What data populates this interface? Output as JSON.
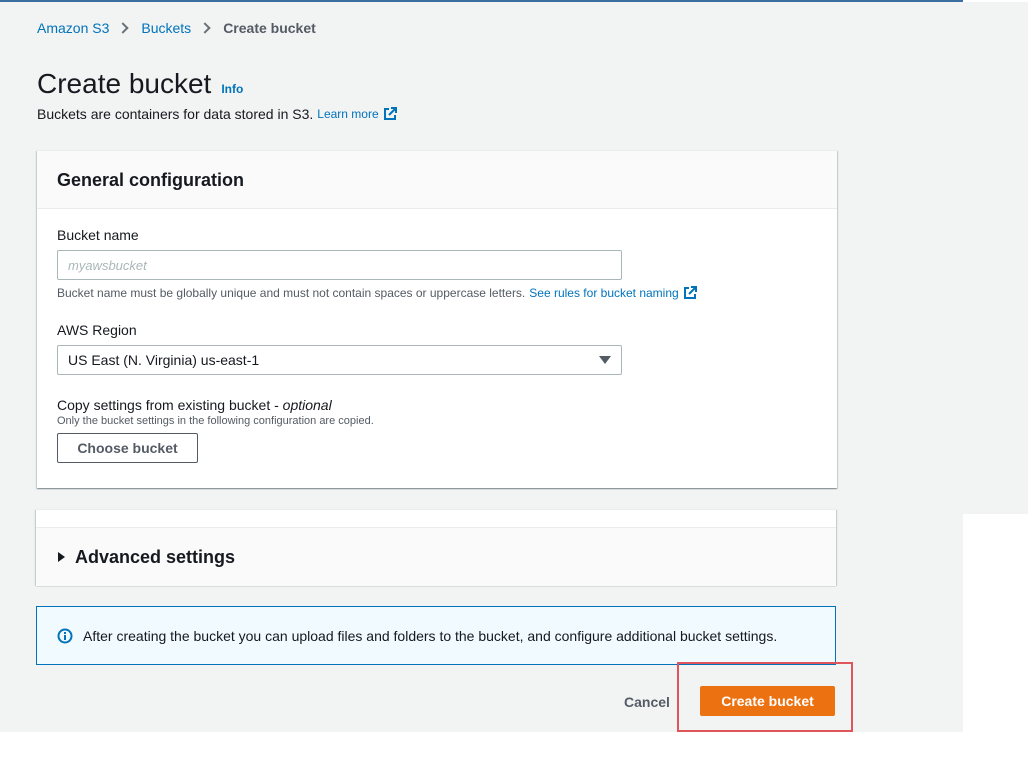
{
  "breadcrumb": {
    "items": [
      "Amazon S3",
      "Buckets"
    ],
    "current": "Create bucket"
  },
  "header": {
    "title": "Create bucket",
    "info": "Info",
    "description": "Buckets are containers for data stored in S3.",
    "learn_more": "Learn more"
  },
  "general_config": {
    "heading": "General configuration",
    "bucket_name_label": "Bucket name",
    "bucket_name_placeholder": "myawsbucket",
    "bucket_name_hint": "Bucket name must be globally unique and must not contain spaces or uppercase letters.",
    "bucket_name_rules_link": "See rules for bucket naming",
    "region_label": "AWS Region",
    "region_value": "US East (N. Virginia) us-east-1",
    "copy_label": "Copy settings from existing bucket - ",
    "copy_optional": "optional",
    "copy_hint": "Only the bucket settings in the following configuration are copied.",
    "choose_bucket": "Choose bucket"
  },
  "advanced": {
    "label": "Advanced settings"
  },
  "alert": {
    "text": "After creating the bucket you can upload files and folders to the bucket, and configure additional bucket settings."
  },
  "actions": {
    "cancel": "Cancel",
    "create": "Create bucket"
  },
  "colors": {
    "link": "#0073bb",
    "primary": "#ec7211",
    "highlight": "#e0545b"
  }
}
